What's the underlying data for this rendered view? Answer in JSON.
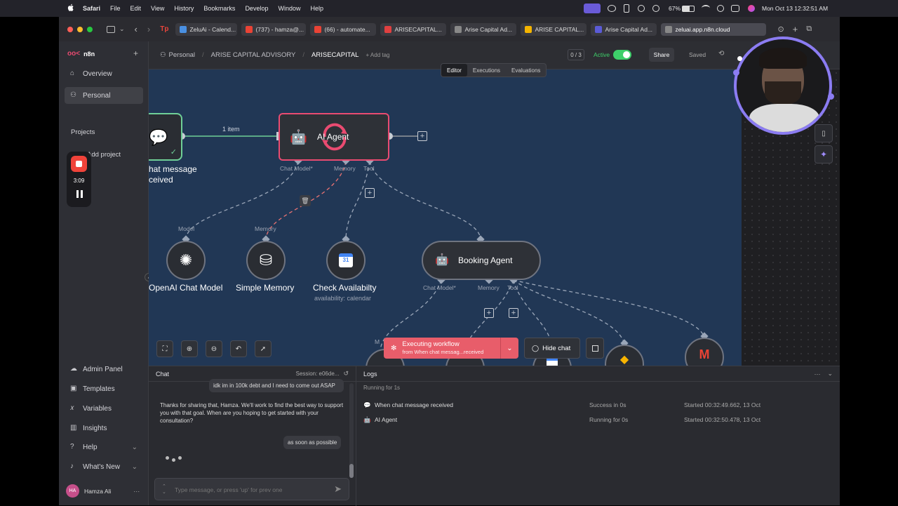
{
  "menubar": {
    "app": "Safari",
    "items": [
      "File",
      "Edit",
      "View",
      "History",
      "Bookmarks",
      "Develop",
      "Window",
      "Help"
    ],
    "battery": "67%",
    "clock": "Mon Oct 13  12:32:51 AM"
  },
  "tabs": [
    {
      "label": "ZeluAi - Calend...",
      "color": "#4a90e2"
    },
    {
      "label": "(737) - hamza@...",
      "color": "#ea4335"
    },
    {
      "label": "(66) - automate...",
      "color": "#ea4335"
    },
    {
      "label": "ARISECAPITAL...",
      "color": "#e04040"
    },
    {
      "label": "Arise Capital Ad...",
      "color": "#888888"
    },
    {
      "label": "ARISE CAPITAL...",
      "color": "#f4b400"
    },
    {
      "label": "Arise Capital Ad...",
      "color": "#5b5bd6"
    },
    {
      "label": "zeluai.app.n8n.cloud",
      "color": "#888888",
      "active": true
    }
  ],
  "sidebar": {
    "brand": "n8n",
    "items": [
      {
        "label": "Overview",
        "icon": "home-icon"
      },
      {
        "label": "Personal",
        "icon": "user-icon",
        "active": true
      }
    ],
    "projects_label": "Projects",
    "add_project": "Add project",
    "bottom": [
      {
        "label": "Admin Panel",
        "icon": "cloud-icon"
      },
      {
        "label": "Templates",
        "icon": "box-icon"
      },
      {
        "label": "Variables",
        "icon": "variable-icon"
      },
      {
        "label": "Insights",
        "icon": "chart-icon"
      },
      {
        "label": "Help",
        "icon": "help-icon"
      },
      {
        "label": "What's New",
        "icon": "bell-icon"
      }
    ],
    "user": {
      "initials": "HA",
      "name": "Hamza Ali"
    }
  },
  "recording": {
    "time": "3:09"
  },
  "header": {
    "breadcrumb_root": "Personal",
    "breadcrumb_folder": "ARISE CAPITAL ADVISORY",
    "workflow_name": "ARISECAPITAL",
    "add_tag": "+ Add tag",
    "counter": "0 / 3",
    "active_label": "Active",
    "share": "Share",
    "saved": "Saved",
    "tabs": [
      "Editor",
      "Executions",
      "Evaluations"
    ]
  },
  "canvas": {
    "trigger_label_1": "hat message",
    "trigger_label_2": "ceived",
    "edge_label": "1 item",
    "agent": "AI Agent",
    "ports": {
      "chat_model": "Chat Model*",
      "memory": "Memory",
      "tool": "Tool"
    },
    "sub_model": "Model",
    "sub_memory": "Memory",
    "nodes": [
      {
        "label": "OpenAI Chat Model"
      },
      {
        "label": "Simple Memory"
      },
      {
        "label": "Check Availabilty",
        "sub": "availability: calendar"
      }
    ],
    "booking_agent": "Booking Agent",
    "booking_ports": {
      "chat_model": "Chat Model*",
      "memory": "Memory",
      "tool": "Tool"
    },
    "partial_label": "M",
    "exec_title": "Executing workflow",
    "exec_sub": "from When chat messag...received",
    "hide_chat": "Hide chat"
  },
  "chat": {
    "title": "Chat",
    "session": "Session: e06de...",
    "messages": [
      {
        "from": "user",
        "text": "idk im in 100k debt and I need to come out ASAP"
      },
      {
        "from": "bot",
        "text": "Thanks for sharing that, Hamza. We'll work to find the best way to support you with that goal. When are you hoping to get started with your consultation?"
      },
      {
        "from": "user",
        "text": "as soon as possible"
      }
    ],
    "placeholder": "Type message, or press 'up' for prev one"
  },
  "logs": {
    "title": "Logs",
    "running": "Running for 1s",
    "rows": [
      {
        "name": "When chat message received",
        "status": "Success in 0s",
        "started": "Started 00:32:49.662, 13 Oct"
      },
      {
        "name": "AI Agent",
        "status": "Running for 0s",
        "started": "Started 00:32:50.478, 13 Oct"
      }
    ]
  },
  "colors": {
    "canvas": "#213755",
    "accent": "#ea4b71",
    "active_toggle": "#3ecf6a"
  }
}
